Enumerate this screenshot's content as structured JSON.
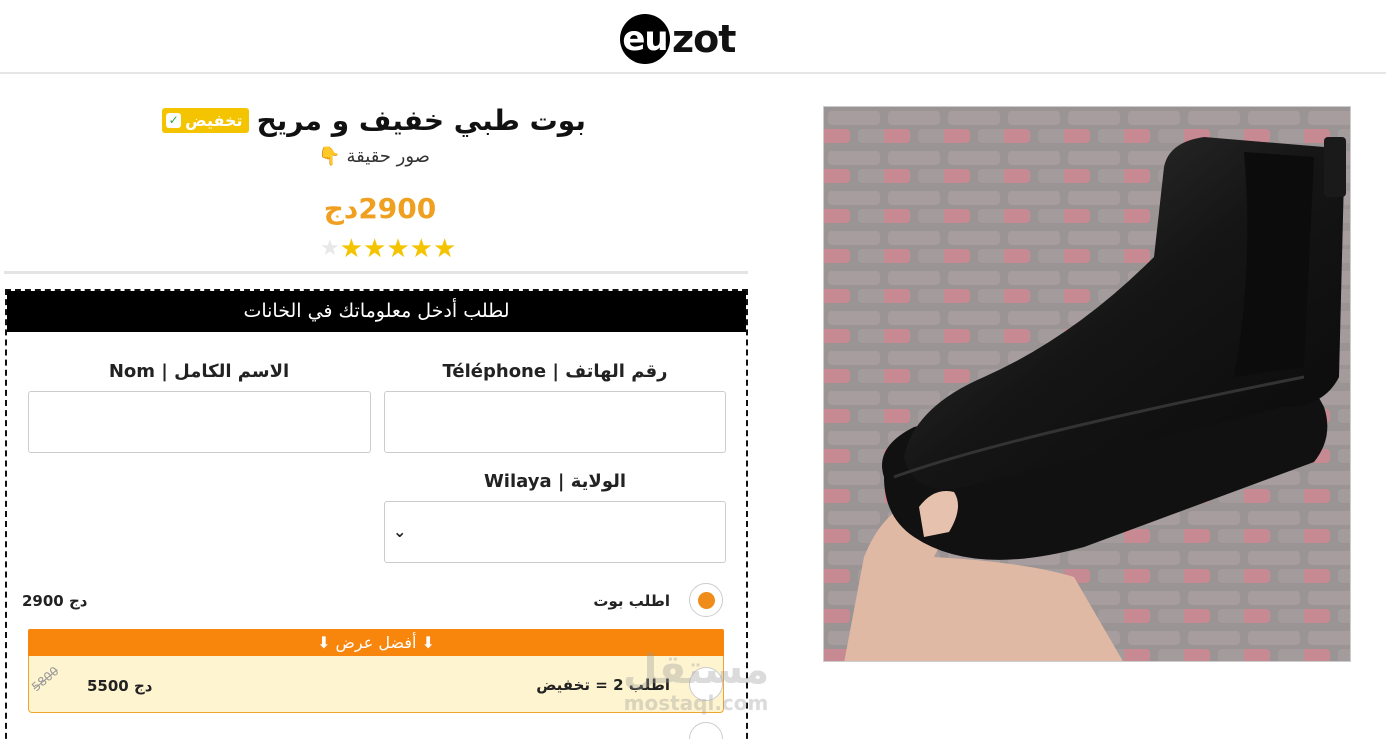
{
  "header": {
    "logo_circle": "eu",
    "logo_rest": "zot"
  },
  "product": {
    "title": "بوت طبي خفيف و مريح",
    "badge": "تخفيض",
    "subtitle": "صور حقيقة",
    "subtitle_emoji": "👇",
    "price": "2900دج",
    "rating": 5
  },
  "form": {
    "header": "لطلب أدخل معلوماتك في الخانات",
    "phone_label": "Téléphone | رقم الهاتف",
    "name_label": "Nom | الاسم الكامل",
    "wilaya_label": "Wilaya | الولاية",
    "phone_value": "",
    "name_value": "",
    "wilaya_value": ""
  },
  "offers": {
    "option1_label": "اطلب بوت",
    "option1_price": "2900 دج",
    "banner": "⬇ أفضل عرض ⬇",
    "option2_label": "اطلب 2 = تخفيض",
    "option2_price": "5500 دج",
    "option2_old_price": "5800"
  },
  "watermark": {
    "arabic": "مستقل",
    "latin": "mostaql.com"
  },
  "colors": {
    "accent": "#f08c1a",
    "badge": "#f5c400",
    "price": "#f0a020"
  }
}
